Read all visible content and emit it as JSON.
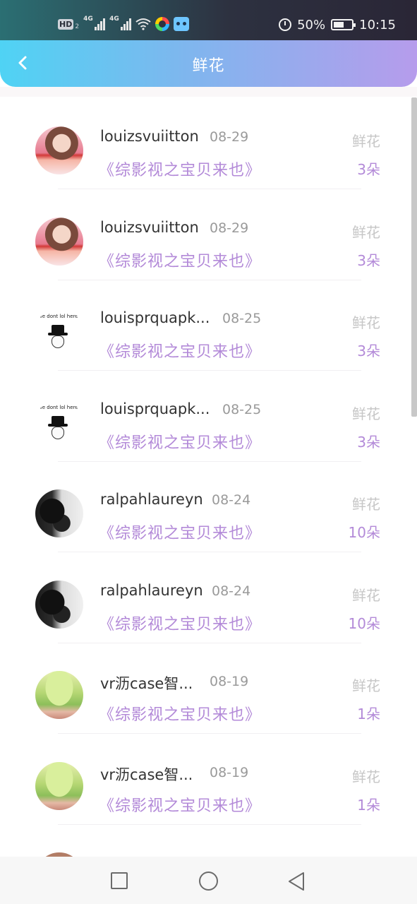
{
  "status_bar": {
    "hd_label": "HD",
    "hd_sub": "2",
    "network_1": "4G",
    "network_2": "4G",
    "battery": "50%",
    "time": "10:15"
  },
  "header": {
    "title": "鲜花"
  },
  "records": [
    {
      "username": "louizsvuiitton",
      "date": "08-29",
      "book": "《综影视之宝贝来也》",
      "gift_type": "鲜花",
      "count": "3朵",
      "avatar": "girl-avatar"
    },
    {
      "username": "louizsvuiitton",
      "date": "08-29",
      "book": "《综影视之宝贝来也》",
      "gift_type": "鲜花",
      "count": "3朵",
      "avatar": "girl-avatar"
    },
    {
      "username": "louisprquapk...",
      "date": "08-25",
      "book": "《综影视之宝贝来也》",
      "gift_type": "鲜花",
      "count": "3朵",
      "avatar": "meme-avatar"
    },
    {
      "username": "louisprquapk...",
      "date": "08-25",
      "book": "《综影视之宝贝来也》",
      "gift_type": "鲜花",
      "count": "3朵",
      "avatar": "meme-avatar"
    },
    {
      "username": "ralpahlaureyn",
      "date": "08-24",
      "book": "《综影视之宝贝来也》",
      "gift_type": "鲜花",
      "count": "10朵",
      "avatar": "smoke-avatar"
    },
    {
      "username": "ralpahlaureyn",
      "date": "08-24",
      "book": "《综影视之宝贝来也》",
      "gift_type": "鲜花",
      "count": "10朵",
      "avatar": "smoke-avatar"
    },
    {
      "username": "vr沥case智...",
      "date": "08-19",
      "book": "《综影视之宝贝来也》",
      "gift_type": "鲜花",
      "count": "1朵",
      "avatar": "cake-avatar"
    },
    {
      "username": "vr沥case智...",
      "date": "08-19",
      "book": "《综影视之宝贝来也》",
      "gift_type": "鲜花",
      "count": "1朵",
      "avatar": "cake-avatar"
    }
  ],
  "meme_caption": "we dont lol here",
  "nav": {
    "recents": "square-icon",
    "home": "circle-icon",
    "back": "triangle-back-icon"
  },
  "colors": {
    "accent": "#b38ad8",
    "header_start": "#4fd3f4",
    "header_end": "#b69cec"
  }
}
